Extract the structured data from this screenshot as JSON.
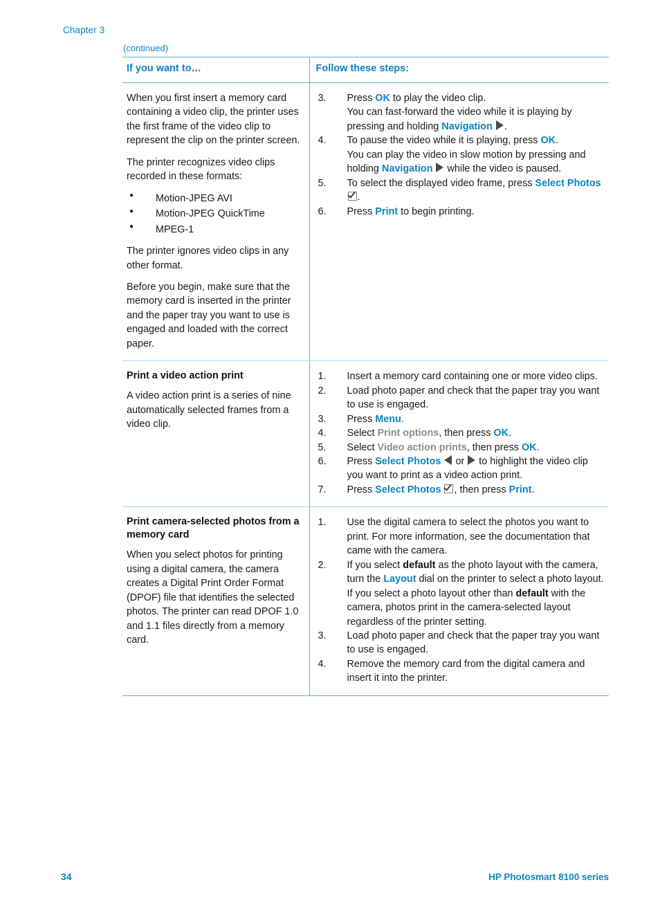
{
  "header": {
    "chapter_label": "Chapter 3",
    "continued_label": "(continued)"
  },
  "table": {
    "columns": [
      {
        "header": "If you want to…"
      },
      {
        "header": "Follow these steps:"
      }
    ],
    "rows": [
      {
        "left": {
          "paragraphs": [
            "When you first insert a memory card containing a video clip, the printer uses the first frame of the video clip to represent the clip on the printer screen.",
            "The printer recognizes video clips recorded in these formats:"
          ],
          "bullets": [
            "Motion-JPEG AVI",
            "Motion-JPEG QuickTime",
            "MPEG-1"
          ],
          "paragraphs_after": [
            "The printer ignores video clips in any other format.",
            "Before you begin, make sure that the memory card is inserted in the printer and the paper tray you want to use is engaged and loaded with the correct paper."
          ]
        },
        "steps": [
          {
            "num": "3.",
            "lines": [
              "Press |blue:OK| to play the video clip.",
              "You can fast-forward the video while it is playing by pressing and holding |blue:Navigation| |icon:arrow-right-icon|."
            ]
          },
          {
            "num": "4.",
            "lines": [
              "To pause the video while it is playing, press |blue:OK|.",
              "You can play the video in slow motion by pressing and holding |blue:Navigation| |icon:arrow-right-icon| while the video is paused."
            ]
          },
          {
            "num": "5.",
            "lines": [
              "To select the displayed video frame, press |blue:Select Photos| |icon:checkbox-icon|."
            ]
          },
          {
            "num": "6.",
            "lines": [
              "Press |blue:Print| to begin printing."
            ]
          }
        ]
      },
      {
        "left": {
          "heading": "Print a video action print",
          "paragraphs": [
            "A video action print is a series of nine automatically selected frames from a video clip."
          ],
          "bullets": [],
          "paragraphs_after": []
        },
        "steps": [
          {
            "num": "1.",
            "lines": [
              "Insert a memory card containing one or more video clips."
            ]
          },
          {
            "num": "2.",
            "lines": [
              "Load photo paper and check that the paper tray you want to use is engaged."
            ]
          },
          {
            "num": "3.",
            "lines": [
              "Press |blue:Menu|."
            ]
          },
          {
            "num": "4.",
            "lines": [
              "Select |gray:Print options|, then press |blue:OK|."
            ]
          },
          {
            "num": "5.",
            "lines": [
              "Select |gray:Video action prints|, then press |blue:OK|."
            ]
          },
          {
            "num": "6.",
            "lines": [
              "Press |blue:Select Photos| |icon:arrow-left-icon| or |icon:arrow-right-icon| to highlight the video clip you want to print as a video action print."
            ]
          },
          {
            "num": "7.",
            "lines": [
              "Press |blue:Select Photos| |icon:checkbox-icon|, then press |blue:Print|."
            ]
          }
        ]
      },
      {
        "left": {
          "heading": "Print camera-selected photos from a memory card",
          "paragraphs": [
            "When you select photos for printing using a digital camera, the camera creates a Digital Print Order Format (DPOF) file that identifies the selected photos. The printer can read DPOF 1.0 and 1.1 files directly from a memory card."
          ],
          "bullets": [],
          "paragraphs_after": []
        },
        "steps": [
          {
            "num": "1.",
            "lines": [
              "Use the digital camera to select the photos you want to print. For more information, see the documentation that came with the camera."
            ]
          },
          {
            "num": "2.",
            "lines": [
              "If you select |bold:default| as the photo layout with the camera, turn the |blue:Layout| dial on the printer to select a photo layout.",
              "If you select a photo layout other than |bold:default| with the camera, photos print in the camera-selected layout regardless of the printer setting."
            ]
          },
          {
            "num": "3.",
            "lines": [
              "Load photo paper and check that the paper tray you want to use is engaged."
            ]
          },
          {
            "num": "4.",
            "lines": [
              "Remove the memory card from the digital camera and insert it into the printer."
            ]
          }
        ]
      }
    ]
  },
  "footer": {
    "page_number": "34",
    "product_name": "HP Photosmart 8100 series"
  },
  "colors": {
    "accent_blue": "#0d84bd",
    "rule_blue": "#5bb4d9",
    "rule_light": "#a8d8ec",
    "gray_term": "#8c8c8c",
    "icon_gray": "#4a4a4a",
    "body_text": "#1a1a1a"
  }
}
